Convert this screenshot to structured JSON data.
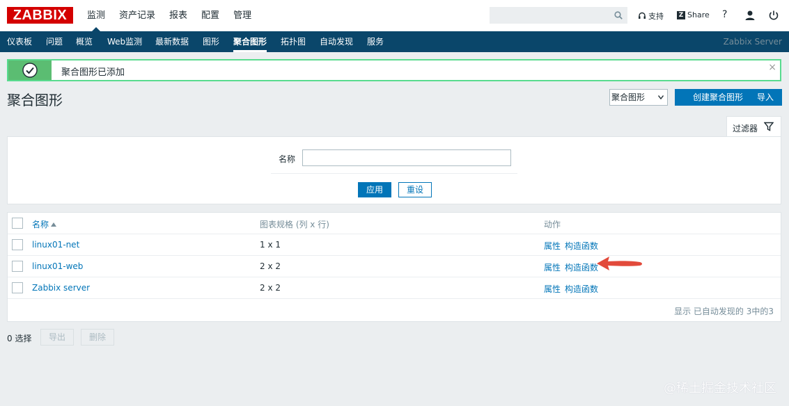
{
  "header": {
    "logo": "ZABBIX",
    "menu": [
      "监测",
      "资产记录",
      "报表",
      "配置",
      "管理"
    ],
    "search_placeholder": "",
    "support": "支持",
    "share": "Share",
    "share_badge": "Z",
    "help": "?"
  },
  "submenu": {
    "items": [
      "仪表板",
      "问题",
      "概览",
      "Web监测",
      "最新数据",
      "图形",
      "聚合图形",
      "拓扑图",
      "自动发现",
      "服务"
    ],
    "server": "Zabbix Server"
  },
  "message": {
    "text": "聚合图形已添加",
    "close": "×"
  },
  "page": {
    "title": "聚合图形",
    "select_value": "聚合图形",
    "create_button": "创建聚合图形",
    "import_button": "导入"
  },
  "filter": {
    "tab": "过滤器",
    "name_label": "名称",
    "name_value": "",
    "apply": "应用",
    "reset": "重设"
  },
  "table": {
    "headers": {
      "name": "名称",
      "size": "图表规格 (列 x 行)",
      "actions": "动作"
    },
    "rows": [
      {
        "name": "linux01-net",
        "size": "1 x 1",
        "prop": "属性",
        "ctor": "构造函数"
      },
      {
        "name": "linux01-web",
        "size": "2 x 2",
        "prop": "属性",
        "ctor": "构造函数"
      },
      {
        "name": "Zabbix server",
        "size": "2 x 2",
        "prop": "属性",
        "ctor": "构造函数"
      }
    ],
    "footer": "显示 已自动发现的 3中的3"
  },
  "bottom": {
    "selected": "0 选择",
    "export": "导出",
    "delete": "删除"
  },
  "watermark": "@稀土掘金技术社区"
}
